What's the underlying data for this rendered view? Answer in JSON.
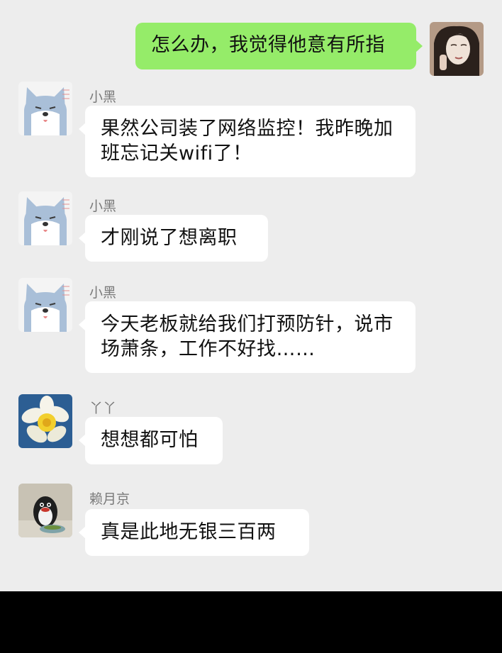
{
  "colors": {
    "background": "#ededed",
    "sent_bubble": "#95ec69",
    "received_bubble": "#ffffff",
    "name_text": "#7a7a7a",
    "bottom_bar": "#000000"
  },
  "messages": [
    {
      "direction": "sent",
      "avatar_icon": "woman-portrait-avatar-icon",
      "text": "怎么办，我觉得他意有所指"
    },
    {
      "direction": "received",
      "sender": "小黑",
      "avatar_icon": "cartoon-dog-avatar-icon",
      "text": "果然公司装了网络监控！我昨晚加班忘记关wifi了！"
    },
    {
      "direction": "received",
      "sender": "小黑",
      "avatar_icon": "cartoon-dog-avatar-icon",
      "text": "才刚说了想离职"
    },
    {
      "direction": "received",
      "sender": "小黑",
      "avatar_icon": "cartoon-dog-avatar-icon",
      "text": "今天老板就给我们打预防针，说市场萧条，工作不好找……"
    },
    {
      "direction": "received",
      "sender": "丫丫",
      "avatar_icon": "daffodil-flower-avatar-icon",
      "text": "想想都可怕"
    },
    {
      "direction": "received",
      "sender": "赖月京",
      "avatar_icon": "penguin-toy-avatar-icon",
      "text": "真是此地无银三百两"
    }
  ]
}
